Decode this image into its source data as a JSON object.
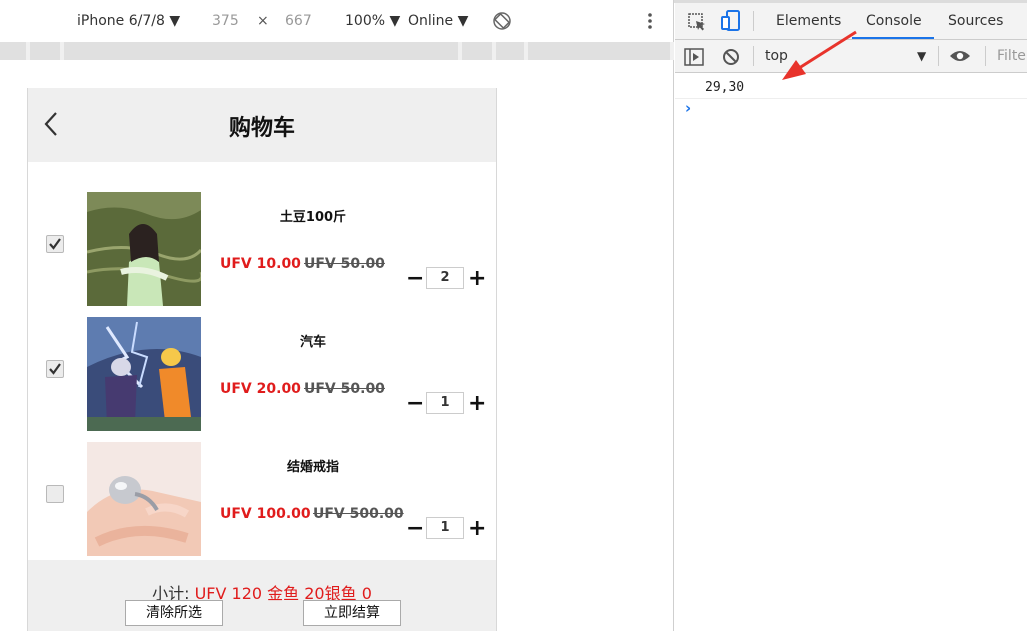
{
  "device_toolbar": {
    "device": "iPhone 6/7/8",
    "width": "375",
    "times": "×",
    "height": "667",
    "zoom": "100%",
    "network": "Online"
  },
  "phone": {
    "title": "购物车",
    "items": [
      {
        "name": "土豆100斤",
        "price": "UFV 10.00",
        "old_price": "UFV 50.00",
        "qty": "2",
        "checked": true
      },
      {
        "name": "汽车",
        "price": "UFV 20.00",
        "old_price": "UFV 50.00",
        "qty": "1",
        "checked": true
      },
      {
        "name": "结婚戒指",
        "price": "UFV 100.00",
        "old_price": "UFV 500.00",
        "qty": "1",
        "checked": false
      }
    ],
    "minus": "−",
    "plus": "+",
    "footer": {
      "subtotal_label": "小计:",
      "subtotal_value": "UFV 120 金鱼 20银鱼 0",
      "clear_button": "清除所选",
      "checkout_button": "立即结算"
    }
  },
  "devtools": {
    "tabs": [
      "Elements",
      "Console",
      "Sources"
    ],
    "active_tab": "Console",
    "context": "top",
    "filter_placeholder": "Filter",
    "console_output": "29,30",
    "prompt": "›"
  },
  "colors": {
    "price": "#e01c1c",
    "accent": "#1a73e8",
    "annotation_arrow": "#e8332b"
  }
}
